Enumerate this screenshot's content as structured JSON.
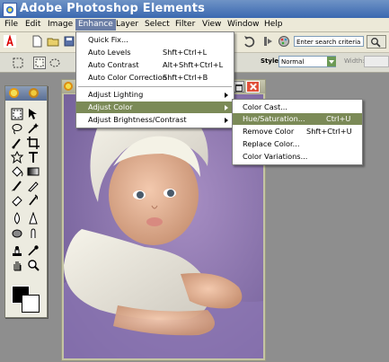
{
  "window": {
    "title": "Adobe Photoshop Elements"
  },
  "menubar": {
    "items": [
      {
        "label": "File"
      },
      {
        "label": "Edit"
      },
      {
        "label": "Image"
      },
      {
        "label": "Enhance"
      },
      {
        "label": "Layer"
      },
      {
        "label": "Select"
      },
      {
        "label": "Filter"
      },
      {
        "label": "View"
      },
      {
        "label": "Window"
      },
      {
        "label": "Help"
      }
    ],
    "active": "Enhance"
  },
  "shortcuts": {
    "search_placeholder": "Enter search criteria",
    "icons": [
      "adobe-logo-icon",
      "new-document-icon",
      "open-folder-icon",
      "save-icon",
      "print-icon",
      "undo-icon",
      "step-backward-icon",
      "palette-icon",
      "search-button-icon"
    ]
  },
  "options": {
    "style_label": "Style:",
    "style_value": "Normal",
    "width_label": "Width:"
  },
  "enhance_menu": {
    "items": [
      {
        "label": "Quick Fix...",
        "shortcut": ""
      },
      {
        "label": "Auto Levels",
        "shortcut": "Shft+Ctrl+L"
      },
      {
        "label": "Auto Contrast",
        "shortcut": "Alt+Shft+Ctrl+L"
      },
      {
        "label": "Auto Color Correction",
        "shortcut": "Shft+Ctrl+B"
      },
      {
        "label": "Adjust Lighting",
        "shortcut": "",
        "submenu": true
      },
      {
        "label": "Adjust Color",
        "shortcut": "",
        "submenu": true,
        "selected": true
      },
      {
        "label": "Adjust Brightness/Contrast",
        "shortcut": "",
        "submenu": true
      }
    ]
  },
  "adjust_color_submenu": {
    "items": [
      {
        "label": "Color Cast...",
        "shortcut": ""
      },
      {
        "label": "Hue/Saturation...",
        "shortcut": "Ctrl+U",
        "selected": true
      },
      {
        "label": "Remove Color",
        "shortcut": "Shft+Ctrl+U"
      },
      {
        "label": "Replace Color...",
        "shortcut": ""
      },
      {
        "label": "Color Variations...",
        "shortcut": ""
      }
    ]
  },
  "colors": {
    "menu_highlight": "#7b8a57",
    "title_bar": "#3a68b0",
    "foreground_color": "#000000",
    "background_color": "#ffffff"
  }
}
